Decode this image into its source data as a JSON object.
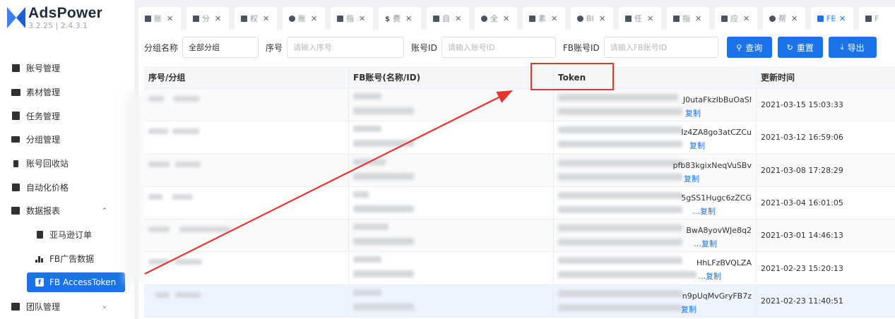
{
  "brand": {
    "name": "AdsPower",
    "version": "3.2.25 | 2.4.3.1"
  },
  "sidebar": {
    "items": [
      {
        "label": "账号管理",
        "icon": "account-icon"
      },
      {
        "label": "素材管理",
        "icon": "folder-icon"
      },
      {
        "label": "任务管理",
        "icon": "task-icon"
      },
      {
        "label": "分组管理",
        "icon": "group-icon"
      },
      {
        "label": "账号回收站",
        "icon": "trash-icon"
      },
      {
        "label": "自动化价格",
        "icon": "price-icon"
      },
      {
        "label": "数据报表",
        "icon": "report-icon",
        "expanded": true
      }
    ],
    "sub_items": [
      {
        "label": "亚马逊订单",
        "icon": "order-icon"
      },
      {
        "label": "FB广告数据",
        "icon": "bar-chart-icon"
      },
      {
        "label": "FB AccessToken",
        "icon": "facebook-icon",
        "active": true
      }
    ],
    "bottom": {
      "label": "团队管理",
      "icon": "team-icon"
    }
  },
  "tabs": [
    {
      "label": "账",
      "icon": "account-icon"
    },
    {
      "label": "分",
      "icon": "group-icon"
    },
    {
      "label": "权",
      "icon": "user-group-icon"
    },
    {
      "label": "账",
      "icon": "info-icon"
    },
    {
      "label": "指",
      "icon": "task-icon"
    },
    {
      "label": "费",
      "icon": "dollar-icon"
    },
    {
      "label": "自",
      "icon": "price-icon"
    },
    {
      "label": "全",
      "icon": "gear-icon"
    },
    {
      "label": "素",
      "icon": "folder-icon"
    },
    {
      "label": "BI",
      "icon": "circle-icon"
    },
    {
      "label": "任",
      "icon": "task-icon"
    },
    {
      "label": "指",
      "icon": "file-icon"
    },
    {
      "label": "应",
      "icon": "grid-icon"
    },
    {
      "label": "帮",
      "icon": "help-icon"
    },
    {
      "label": "FB",
      "icon": "facebook-icon",
      "active": true
    },
    {
      "label": "F",
      "icon": "bar-chart-icon"
    }
  ],
  "filters": {
    "group_label": "分组名称",
    "group_value": "全部分组",
    "serial_label": "序号",
    "serial_placeholder": "请输入序号",
    "account_label": "账号ID",
    "account_placeholder": "请输入账号ID",
    "fb_label": "FB账号ID",
    "fb_placeholder": "请输入FB账号ID",
    "query_button": "查询",
    "reset_button": "重置",
    "export_button": "导出"
  },
  "table": {
    "columns": [
      "序号/分组",
      "FB账号(名称/ID)",
      "Token",
      "更新时间"
    ],
    "copy_label": "复制",
    "rows": [
      {
        "token_tail": "J0utaFkzIbBuOaSI",
        "updated": "2021-03-15 15:03:33"
      },
      {
        "token_tail": "Iz4ZA8go3atCZCu",
        "updated": "2021-03-12 16:59:06"
      },
      {
        "token_tail": "pfb83kgixNeqVuSBv",
        "updated": "2021-03-08 17:28:29"
      },
      {
        "token_tail": "5gSS1Hugc6zZCG",
        "updated": "2021-03-04 16:01:05"
      },
      {
        "token_tail": "BwA8yovWJe8q2",
        "updated": "2021-03-01 14:46:13"
      },
      {
        "token_tail": "HhLFzBVQLZA",
        "updated": "2021-02-23 15:20:13"
      },
      {
        "token_tail": "n9pUqMvGryFB7z",
        "updated": "2021-02-23 11:40:51"
      }
    ]
  },
  "annotation": {
    "color": "#e8342e"
  },
  "colors": {
    "accent": "#1a73e8",
    "annotation": "#e8342e"
  }
}
